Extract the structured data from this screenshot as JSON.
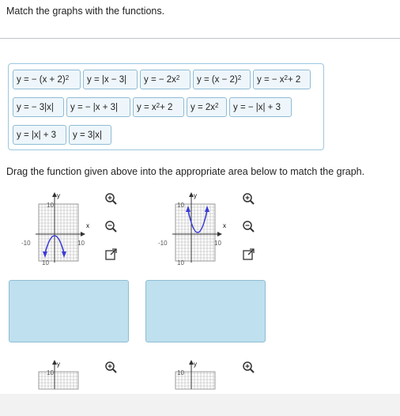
{
  "instruction": "Match the graphs with the functions.",
  "drag_instruction": "Drag the function given above into the appropriate area below to match the graph.",
  "functions": [
    {
      "base": "y = − (x + 2)",
      "sup": "2"
    },
    {
      "base": "y = |x − 3|",
      "sup": ""
    },
    {
      "base": "y = − 2x",
      "sup": "2"
    },
    {
      "base": "y = (x − 2)",
      "sup": "2"
    },
    {
      "base": "y = − x",
      "sup": "2",
      "tail": " + 2"
    },
    {
      "base": "y = − 3|x|",
      "sup": ""
    },
    {
      "base": "y = − |x + 3|",
      "sup": ""
    },
    {
      "base": "y = x",
      "sup": "2",
      "tail": " + 2"
    },
    {
      "base": "y = 2x",
      "sup": "2"
    },
    {
      "base": "y = − |x| + 3",
      "sup": ""
    },
    {
      "base": "y = |x| + 3",
      "sup": ""
    },
    {
      "base": "y = 3|x|",
      "sup": ""
    }
  ],
  "graphs": [
    {
      "y_label": "y",
      "x_label": "x",
      "tick_top": "10",
      "tick_bottom": "10",
      "tick_left": "-10",
      "tick_right": "10"
    },
    {
      "y_label": "y",
      "x_label": "x",
      "tick_top": "10",
      "tick_bottom": "10",
      "tick_left": "-10",
      "tick_right": "10"
    },
    {
      "y_label": "y",
      "tick_top": "10"
    },
    {
      "y_label": "y",
      "tick_top": "10"
    }
  ],
  "colors": {
    "curve": "#3b3bd6",
    "drop_zone": "#bfe0ee",
    "chip_bg": "#eef6fb",
    "border": "#8fbcd4"
  },
  "icons": [
    "zoom-in-icon",
    "zoom-out-icon",
    "expand-icon"
  ]
}
